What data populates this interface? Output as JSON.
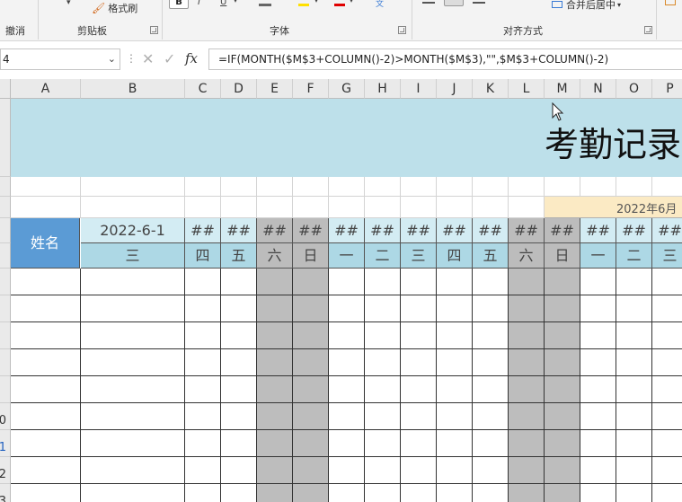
{
  "ribbon": {
    "undo_label": "撤消",
    "clipboard_label": "剪贴板",
    "format_painter_label": "格式刷",
    "font_label": "字体",
    "alignment_label": "对齐方式",
    "merge_label": "合并后居中",
    "bold_glyph": "B",
    "italic_glyph": "I",
    "underline_glyph": "U"
  },
  "formula_bar": {
    "name_box": "4",
    "fx_label": "fx",
    "formula": "=IF(MONTH($M$3+COLUMN()-2)>MONTH($M$3),\"\",$M$3+COLUMN()-2)"
  },
  "columns": [
    "A",
    "B",
    "C",
    "D",
    "E",
    "F",
    "G",
    "H",
    "I",
    "J",
    "K",
    "L",
    "M",
    "N",
    "O",
    "P"
  ],
  "row_numbers": [
    "0",
    "1",
    "2",
    "3"
  ],
  "sheet": {
    "title": "考勤记录",
    "month_label": "2022年6月",
    "name_header": "姓名",
    "first_date": "2022-6-1",
    "date_overflow": "##",
    "weekdays": [
      "三",
      "四",
      "五",
      "六",
      "日",
      "一",
      "二",
      "三",
      "四",
      "五",
      "六",
      "日",
      "一",
      "二",
      "三"
    ]
  },
  "colors": {
    "title_band": "#bde0ea",
    "name_header": "#5b9bd5",
    "weekend": "#bcbcbc",
    "month_bar": "#fbeac4"
  }
}
